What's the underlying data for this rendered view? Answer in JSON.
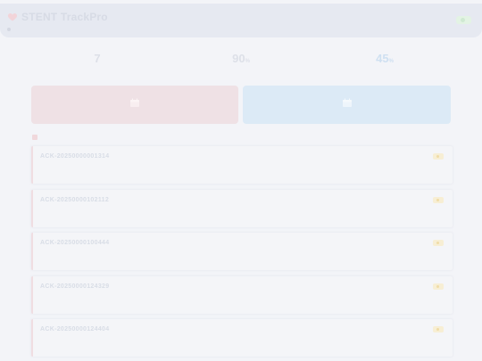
{
  "header": {
    "title": "STENT TrackPro",
    "subtitle": "",
    "sync_label": "",
    "last_sync": ""
  },
  "stats": [
    {
      "label": "",
      "value": "7",
      "unit": ""
    },
    {
      "label": "",
      "value": "90",
      "unit": "%"
    },
    {
      "label": "",
      "value": "45",
      "unit": "%"
    }
  ],
  "actions": [
    {
      "label": "",
      "icon": "calendar-icon"
    },
    {
      "label": "",
      "icon": "calendar-icon"
    }
  ],
  "section": {
    "title": ""
  },
  "records": [
    {
      "id": "ACK-20250000001314",
      "line1": "",
      "line2": "",
      "status": ""
    },
    {
      "id": "ACK-20250000102112",
      "line1": "",
      "line2": "",
      "status": ""
    },
    {
      "id": "ACK-20250000100444",
      "line1": "",
      "line2": "",
      "status": ""
    },
    {
      "id": "ACK-20250000124329",
      "line1": "",
      "line2": "",
      "status": ""
    },
    {
      "id": "ACK-20250000124404",
      "line1": "",
      "line2": "",
      "status": ""
    }
  ],
  "colors": {
    "background": "#f3f4f8",
    "topbar": "#e6e9f1",
    "accent_red": "#efe1e5",
    "accent_blue": "#dceaf6",
    "badge_pending": "#f7eed4"
  }
}
